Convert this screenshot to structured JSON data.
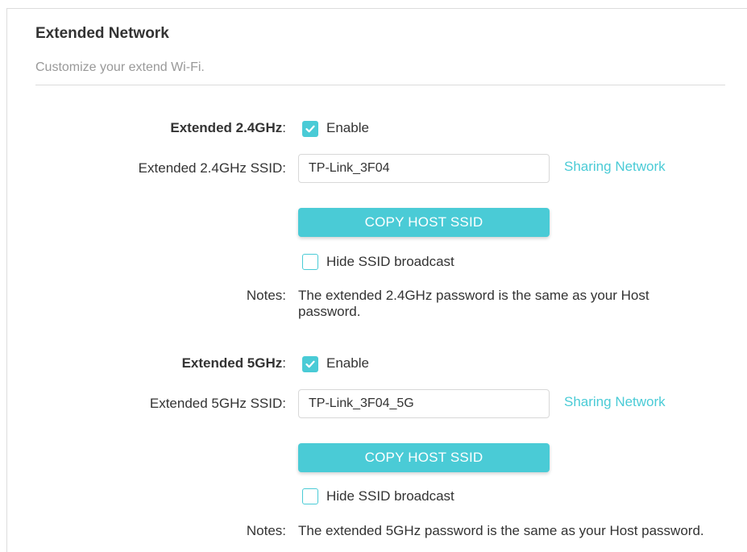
{
  "header": {
    "title": "Extended Network",
    "subtitle": "Customize your extend Wi-Fi."
  },
  "sections": [
    {
      "band_label": "Extended 2.4GHz",
      "colon": ":",
      "enable_label": "Enable",
      "enable_checked": true,
      "ssid_label": "Extended 2.4GHz SSID:",
      "ssid_value": "TP-Link_3F04",
      "sharing_link": "Sharing Network",
      "copy_button": "COPY HOST SSID",
      "hide_label": "Hide SSID broadcast",
      "hide_checked": false,
      "notes_label": "Notes:",
      "notes_text": "The extended 2.4GHz password is the same as your Host password."
    },
    {
      "band_label": "Extended 5GHz",
      "colon": ":",
      "enable_label": "Enable",
      "enable_checked": true,
      "ssid_label": "Extended 5GHz SSID:",
      "ssid_value": "TP-Link_3F04_5G",
      "sharing_link": "Sharing Network",
      "copy_button": "COPY HOST SSID",
      "hide_label": "Hide SSID broadcast",
      "hide_checked": false,
      "notes_label": "Notes:",
      "notes_text": "The extended 5GHz password is the same as your Host password."
    }
  ],
  "colors": {
    "accent": "#4acbd6",
    "text": "#333333",
    "muted": "#999999",
    "border": "#dcdcdc"
  }
}
